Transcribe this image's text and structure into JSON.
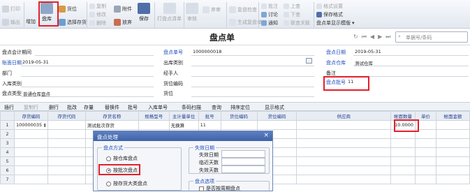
{
  "toolbar": {
    "print": "打印",
    "export": "输出",
    "dup": "增加",
    "inventory": "盘库",
    "warehouse": "货位",
    "select_stock": "选择存货",
    "copy": "复制",
    "modify": "修改",
    "delete": "删除",
    "attach": "附件",
    "abandon": "放弃",
    "save": "保存",
    "print_plan": "打盘点清单",
    "audit": "审核",
    "abandon_audit": "弃审",
    "review_check": "复盘检查",
    "gen_review": "生成复盘单",
    "annotate": "批注",
    "discuss": "讨论",
    "notify": "通知",
    "up": "上查",
    "down": "下查",
    "related": "联查关联",
    "format_setting": "格式设置",
    "save_format": "保存格式",
    "display_template": "盘点单显示模版"
  },
  "header": {
    "title": "盘点单",
    "search_placeholder": "单据号/条码"
  },
  "form": {
    "period_label": "盘点会计期间",
    "doc_no_label": "盘点单号",
    "doc_no": "1000000018",
    "date_label": "盘点日期",
    "date": "2019-05-31",
    "account_date_label": "账面日期",
    "account_date": "2019-05-31",
    "out_type_label": "出库类别",
    "warehouse_label": "盘点仓库",
    "warehouse": "测试仓库",
    "dept_label": "部门",
    "handler_label": "经手人",
    "note_label": "备注",
    "in_type_label": "入库类别",
    "loc_code_label": "货位编码",
    "batch_label": "盘点批号",
    "batch": "11",
    "type_label": "盘点类型",
    "type": "普通仓库盘点",
    "loc_label": "货位"
  },
  "grid_toolbar": {
    "insert": "插行",
    "copy_row": "复制行",
    "delete_row": "删行",
    "batch_change": "批改",
    "stock": "存量",
    "replace": "替换件",
    "batch_no": "批号",
    "in_doc": "入库单号",
    "barcode": "条码扫描",
    "query": "查询",
    "sort": "排序定位",
    "display_format": "显示格式"
  },
  "grid": {
    "headers": [
      "",
      "存货编码",
      "存货代码",
      "存货名称",
      "规格型号",
      "主计量单位",
      "批号",
      "货位编码",
      "货位编码",
      "供应商",
      "帐面数量",
      "单价",
      "帐面金额"
    ],
    "rows": [
      {
        "num": "1",
        "code": "100000035",
        "name": "测试批次存货",
        "unit": "无换算",
        "batch": "11",
        "qty": "10.0000"
      },
      {
        "num": "2"
      },
      {
        "num": "3"
      },
      {
        "num": "4"
      },
      {
        "num": "5"
      },
      {
        "num": "6"
      },
      {
        "num": "7"
      }
    ]
  },
  "dialog": {
    "title": "盘点处理",
    "method_label": "盘点方式",
    "opt1": "按仓库盘点",
    "opt2": "按批次盘点",
    "opt3": "按存货大类盘点",
    "expire_label": "失效日期",
    "expire_date": "失效日期",
    "near_days": "临近天数",
    "expire_days": "失效天数",
    "options_label": "盘点选项",
    "opt_zero": "是否按周期盘点"
  },
  "colors": {
    "highlight": "#e3202c",
    "dialog_header": "#4a6db3"
  }
}
